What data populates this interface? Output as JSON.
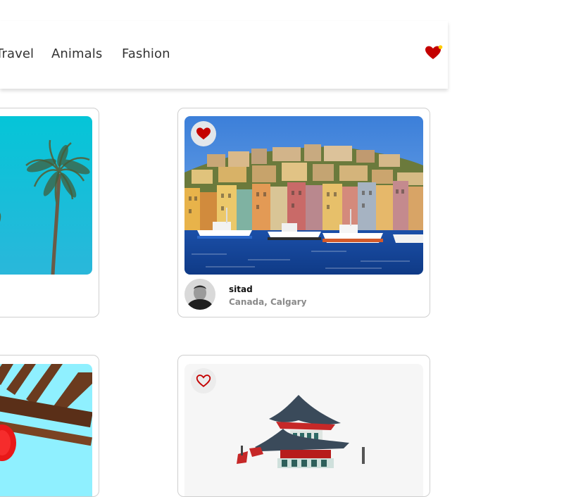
{
  "nav": {
    "links": [
      "Travel",
      "Animals",
      "Fashion"
    ],
    "favorites_icon": "heart-sparkle-icon"
  },
  "cards": [
    {
      "image": "palm-tree-sky",
      "favorited": false
    },
    {
      "image": "harbor-town",
      "favorited": true,
      "author": {
        "name": "sitad",
        "location": "Canada, Calgary"
      }
    },
    {
      "image": "wooden-pergola-lanterns",
      "favorited": false
    },
    {
      "image": "pagoda-temple",
      "favorited": false
    }
  ],
  "colors": {
    "heart": "#c40000",
    "accent_star": "#ffcc00",
    "card_border": "#cfcfcf",
    "text_muted": "#8a8a8a"
  }
}
